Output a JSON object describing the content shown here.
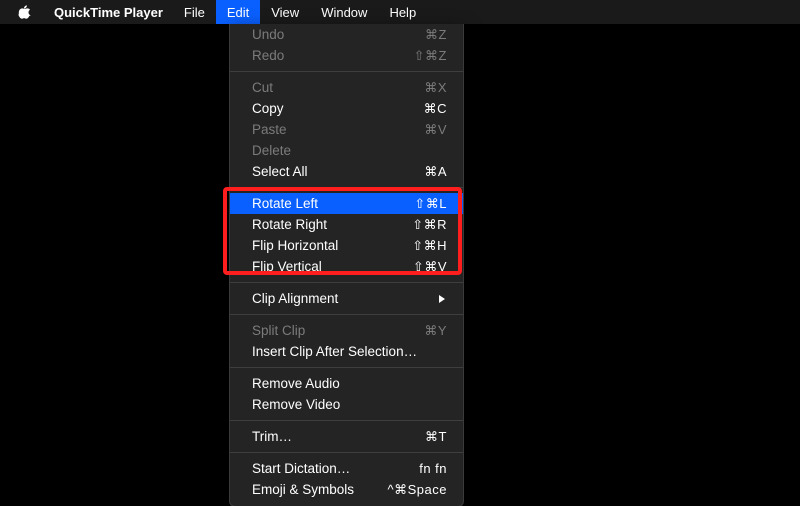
{
  "menubar": {
    "app_name": "QuickTime Player",
    "items": [
      {
        "label": "File",
        "active": false
      },
      {
        "label": "Edit",
        "active": true
      },
      {
        "label": "View",
        "active": false
      },
      {
        "label": "Window",
        "active": false
      },
      {
        "label": "Help",
        "active": false
      }
    ]
  },
  "dropdown": {
    "groups": [
      [
        {
          "label": "Undo",
          "shortcut": "⌘Z",
          "disabled": true
        },
        {
          "label": "Redo",
          "shortcut": "⇧⌘Z",
          "disabled": true
        }
      ],
      [
        {
          "label": "Cut",
          "shortcut": "⌘X",
          "disabled": true
        },
        {
          "label": "Copy",
          "shortcut": "⌘C",
          "disabled": false
        },
        {
          "label": "Paste",
          "shortcut": "⌘V",
          "disabled": true
        },
        {
          "label": "Delete",
          "shortcut": "",
          "disabled": true
        },
        {
          "label": "Select All",
          "shortcut": "⌘A",
          "disabled": false
        }
      ],
      [
        {
          "label": "Rotate Left",
          "shortcut": "⇧⌘L",
          "disabled": false,
          "selected": true
        },
        {
          "label": "Rotate Right",
          "shortcut": "⇧⌘R",
          "disabled": false
        },
        {
          "label": "Flip Horizontal",
          "shortcut": "⇧⌘H",
          "disabled": false
        },
        {
          "label": "Flip Vertical",
          "shortcut": "⇧⌘V",
          "disabled": false
        }
      ],
      [
        {
          "label": "Clip Alignment",
          "shortcut": "",
          "disabled": false,
          "submenu": true
        }
      ],
      [
        {
          "label": "Split Clip",
          "shortcut": "⌘Y",
          "disabled": true
        },
        {
          "label": "Insert Clip After Selection…",
          "shortcut": "",
          "disabled": false
        }
      ],
      [
        {
          "label": "Remove Audio",
          "shortcut": "",
          "disabled": false
        },
        {
          "label": "Remove Video",
          "shortcut": "",
          "disabled": false
        }
      ],
      [
        {
          "label": "Trim…",
          "shortcut": "⌘T",
          "disabled": false
        }
      ],
      [
        {
          "label": "Start Dictation…",
          "shortcut": "fn fn",
          "disabled": false
        },
        {
          "label": "Emoji & Symbols",
          "shortcut": "^⌘Space",
          "disabled": false
        }
      ]
    ]
  },
  "annotation": {
    "highlight_group_index": 2
  }
}
